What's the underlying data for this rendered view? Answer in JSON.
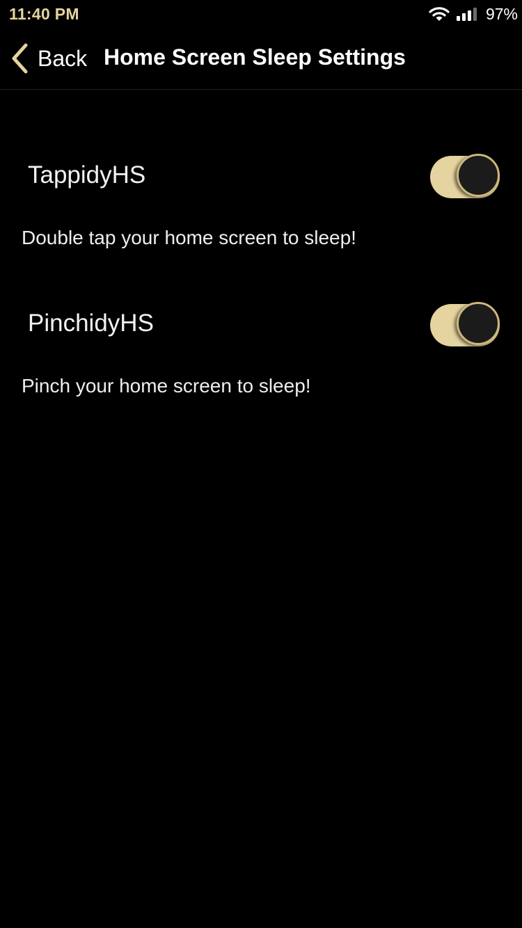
{
  "status_bar": {
    "time": "11:40 PM",
    "battery": "97%",
    "icons": [
      "wifi-icon",
      "cellular-signal-icon"
    ],
    "time_color": "#e5d3a0"
  },
  "nav": {
    "back_label": "Back",
    "title": "Home Screen Sleep Settings",
    "back_icon": "chevron-left-icon"
  },
  "settings": [
    {
      "label": "TappidyHS",
      "description": "Double tap your home screen to sleep!",
      "enabled": true
    },
    {
      "label": "PinchidyHS",
      "description": "Pinch your home screen to sleep!",
      "enabled": true
    }
  ],
  "colors": {
    "accent": "#e5d3a0",
    "knob_fill": "#1b1b1b",
    "knob_ring": "#cdb77a",
    "background": "#000000"
  }
}
